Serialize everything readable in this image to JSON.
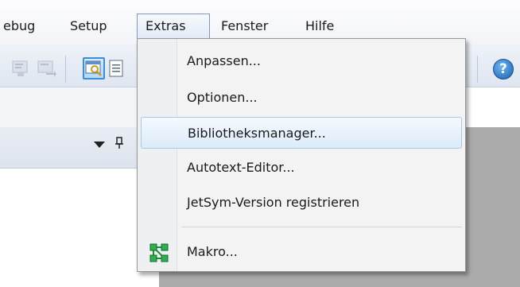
{
  "menubar": {
    "items": [
      {
        "label": "ebug"
      },
      {
        "label": "Setup"
      },
      {
        "label": "Extras"
      },
      {
        "label": "Fenster"
      },
      {
        "label": "Hilfe"
      }
    ]
  },
  "toolbar": {
    "help_label": "?"
  },
  "extras_menu": {
    "items": [
      {
        "label": "Anpassen..."
      },
      {
        "label": "Optionen..."
      },
      {
        "label": "Bibliotheksmanager..."
      },
      {
        "label": "Autotext-Editor..."
      },
      {
        "label": "JetSym-Version registrieren"
      },
      {
        "label": "Makro...",
        "icon": "macro-icon"
      }
    ],
    "highlighted_index": 2
  },
  "panel": {
    "pin_glyph": "ᵽ"
  },
  "colors": {
    "menu_bg": "#f3f3f3",
    "highlight_border": "#a8c8ea",
    "workarea": "#ababab",
    "macro_icon": "#1f8f3a"
  }
}
